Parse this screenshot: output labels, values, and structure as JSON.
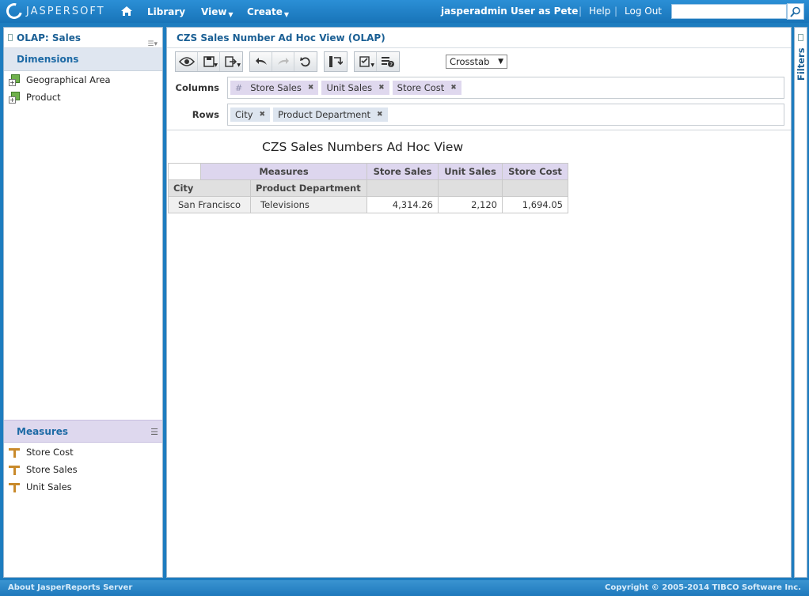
{
  "topbar": {
    "logo_text": "JASPERSOFT",
    "nav": {
      "library": "Library",
      "view": "View",
      "create": "Create"
    },
    "user": "jasperadmin User as Pete",
    "help": "Help",
    "logout": "Log Out",
    "search_value": ""
  },
  "left": {
    "title": "OLAP: Sales",
    "dimensions_label": "Dimensions",
    "dimensions": [
      "Geographical Area",
      "Product"
    ],
    "measures_label": "Measures",
    "measures": [
      "Store Cost",
      "Store Sales",
      "Unit Sales"
    ]
  },
  "main": {
    "title": "CZS Sales Number Ad Hoc View (OLAP)",
    "view_type": "Crosstab",
    "columns_label": "Columns",
    "rows_label": "Rows",
    "columns_hash": "#",
    "columns": [
      "Store Sales",
      "Unit Sales",
      "Store Cost"
    ],
    "rows": [
      "City",
      "Product Department"
    ],
    "report_title": "CZS Sales Numbers Ad Hoc View"
  },
  "crosstab": {
    "measures_header": "Measures",
    "measure_cols": [
      "Store Sales",
      "Unit Sales",
      "Store Cost"
    ],
    "row_headers": [
      "City",
      "Product Department"
    ],
    "rows": [
      {
        "city": "San Francisco",
        "department": "Televisions",
        "values": [
          "4,314.26",
          "2,120",
          "1,694.05"
        ]
      }
    ]
  },
  "filters_label": "Filters",
  "footer": {
    "about": "About JasperReports Server",
    "copyright": "Copyright © 2005-2014 TIBCO Software Inc."
  },
  "colors": {
    "brand_blue": "#1d7cbf",
    "measure_purple": "#ddd6ee",
    "link_blue": "#1a5f94"
  }
}
